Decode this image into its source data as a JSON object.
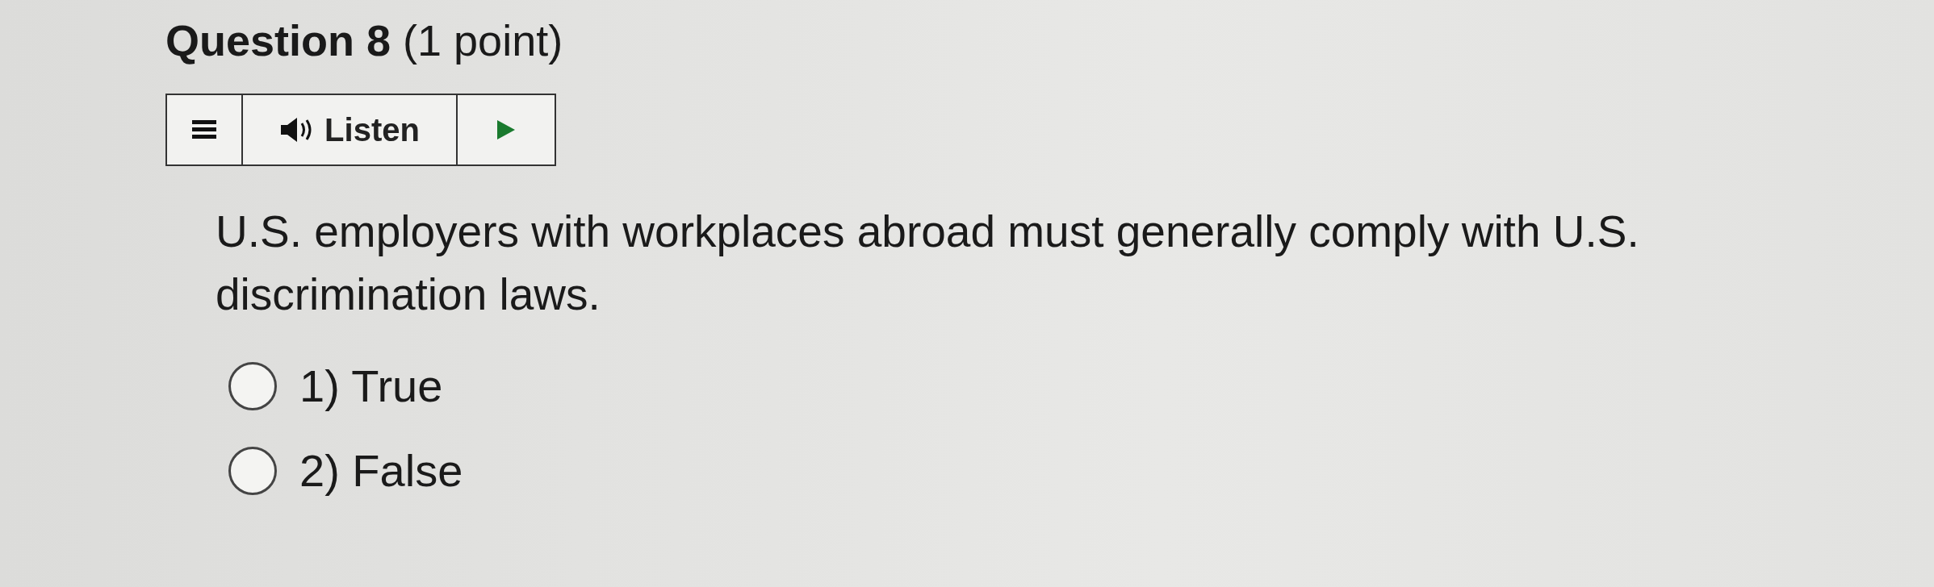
{
  "question": {
    "title": "**Question 8** (1 point)"
  },
  "toolbar": {
    "listen_label": "Listen"
  },
  "prompt": "U.S. employers with workplaces abroad must generally comply with U.S. discrimination laws.",
  "options": [
    {
      "label": "1) True",
      "selected": false
    },
    {
      "label": "2) False",
      "selected": false
    }
  ]
}
